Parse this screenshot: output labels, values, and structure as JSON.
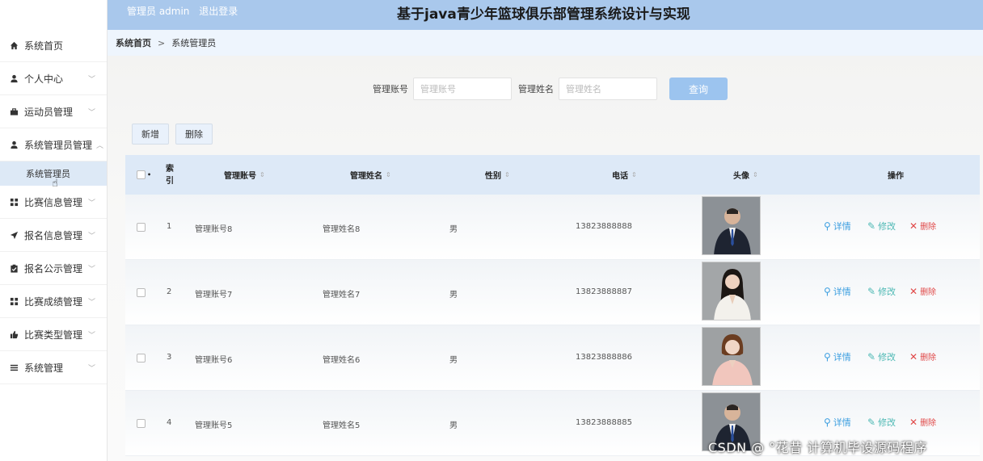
{
  "header": {
    "user_role": "管理员 admin",
    "logout": "退出登录",
    "title": "基于java青少年篮球俱乐部管理系统设计与实现"
  },
  "sidebar": {
    "items": [
      {
        "label": "系统首页",
        "icon": "home-icon"
      },
      {
        "label": "个人中心",
        "icon": "user-icon"
      },
      {
        "label": "运动员管理",
        "icon": "briefcase-icon"
      },
      {
        "label": "系统管理员管理",
        "icon": "user-icon"
      },
      {
        "label": "比赛信息管理",
        "icon": "grid-icon"
      },
      {
        "label": "报名信息管理",
        "icon": "send-icon"
      },
      {
        "label": "报名公示管理",
        "icon": "clipboard-icon"
      },
      {
        "label": "比赛成绩管理",
        "icon": "grid-icon"
      },
      {
        "label": "比赛类型管理",
        "icon": "thumbs-up-icon"
      },
      {
        "label": "系统管理",
        "icon": "list-icon"
      }
    ],
    "submenu": {
      "label": "系统管理员"
    }
  },
  "breadcrumb": {
    "home": "系统首页",
    "separator": ">",
    "current": "系统管理员"
  },
  "search": {
    "account_label": "管理账号",
    "account_placeholder": "管理账号",
    "name_label": "管理姓名",
    "name_placeholder": "管理姓名",
    "button": "查询"
  },
  "actions": {
    "add": "新增",
    "delete": "删除"
  },
  "table": {
    "headers": {
      "index": "索引",
      "account": "管理账号",
      "name": "管理姓名",
      "gender": "性别",
      "phone": "电话",
      "avatar": "头像",
      "operation": "操作"
    },
    "rows": [
      {
        "index": "1",
        "account": "管理账号8",
        "name": "管理姓名8",
        "gender": "男",
        "phone": "13823888888"
      },
      {
        "index": "2",
        "account": "管理账号7",
        "name": "管理姓名7",
        "gender": "男",
        "phone": "13823888887"
      },
      {
        "index": "3",
        "account": "管理账号6",
        "name": "管理姓名6",
        "gender": "男",
        "phone": "13823888886"
      },
      {
        "index": "4",
        "account": "管理账号5",
        "name": "管理姓名5",
        "gender": "男",
        "phone": "13823888885"
      }
    ],
    "ops": {
      "detail": "详情",
      "edit": "修改",
      "delete": "删除"
    }
  },
  "watermark": "CSDN @ °花昔  计算机毕设源码程序",
  "colors": {
    "header_bg": "#a9c8ec",
    "accent": "#9cc4ef",
    "detail": "#3d9fe0",
    "edit": "#4db8b4",
    "delete": "#e04848"
  }
}
